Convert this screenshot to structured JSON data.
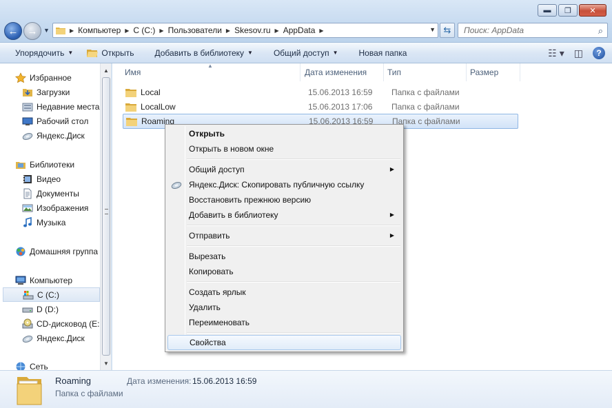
{
  "window": {
    "minimize": "▬",
    "maximize": "❐",
    "close": "✕"
  },
  "nav": {
    "back": "←",
    "forward": "→",
    "history": "▼"
  },
  "address": {
    "crumbs": [
      "Компьютер",
      "C (C:)",
      "Пользователи",
      "Skesov.ru",
      "AppData"
    ]
  },
  "search": {
    "placeholder": "Поиск: AppData"
  },
  "commands": {
    "organize": "Упорядочить",
    "open": "Открыть",
    "add_to_library": "Добавить в библиотеку",
    "share": "Общий доступ",
    "new_folder": "Новая папка"
  },
  "sidebar": {
    "favorites": "Избранное",
    "downloads": "Загрузки",
    "recent": "Недавние места",
    "desktop": "Рабочий стол",
    "yadisk": "Яндекс.Диск",
    "libraries": "Библиотеки",
    "video": "Видео",
    "documents": "Документы",
    "images": "Изображения",
    "music": "Музыка",
    "homegroup": "Домашняя группа",
    "computer": "Компьютер",
    "drive_c": "C (C:)",
    "drive_d": "D (D:)",
    "cd": "CD-дисковод (E:",
    "yadisk2": "Яндекс.Диск",
    "network": "Сеть"
  },
  "columns": {
    "name": "Имя",
    "date": "Дата изменения",
    "type": "Тип",
    "size": "Размер"
  },
  "files": [
    {
      "name": "Local",
      "date": "15.06.2013 16:59",
      "type": "Папка с файлами"
    },
    {
      "name": "LocalLow",
      "date": "15.06.2013 17:06",
      "type": "Папка с файлами"
    },
    {
      "name": "Roaming",
      "date": "15.06.2013 16:59",
      "type": "Папка с файлами"
    }
  ],
  "context_menu": {
    "open": "Открыть",
    "open_new_window": "Открыть в новом окне",
    "share": "Общий доступ",
    "yadisk_copy": "Яндекс.Диск: Скопировать публичную ссылку",
    "restore": "Восстановить прежнюю версию",
    "add_to_library": "Добавить в библиотеку",
    "send_to": "Отправить",
    "cut": "Вырезать",
    "copy": "Копировать",
    "create_shortcut": "Создать ярлык",
    "delete": "Удалить",
    "rename": "Переименовать",
    "properties": "Свойства"
  },
  "details": {
    "name": "Roaming",
    "type": "Папка с файлами",
    "date_label": "Дата изменения:",
    "date_value": "15.06.2013 16:59"
  }
}
